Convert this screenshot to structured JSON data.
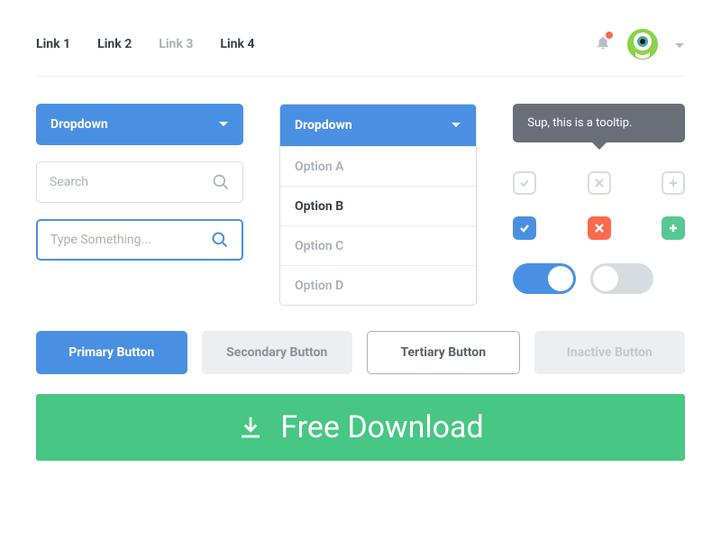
{
  "nav": {
    "links": [
      "Link 1",
      "Link 2",
      "Link 3",
      "Link 4"
    ],
    "muted_index": 2
  },
  "dropdown": {
    "label": "Dropdown"
  },
  "search": {
    "placeholder_gray": "Search",
    "placeholder_blue": "Type Something..."
  },
  "dd_open": {
    "label": "Dropdown",
    "options": [
      "Option A",
      "Option B",
      "Option C",
      "Option D"
    ],
    "selected_index": 1
  },
  "tooltip": {
    "text": "Sup, this is a tooltip."
  },
  "buttons": {
    "primary": "Primary Button",
    "secondary": "Secondary Button",
    "tertiary": "Tertiary Button",
    "inactive": "Inactive Button"
  },
  "cta": {
    "label": "Free Download"
  },
  "colors": {
    "blue": "#4a90e2",
    "green": "#47c684",
    "red": "#f96b4c",
    "gray": "#d7dce1"
  }
}
